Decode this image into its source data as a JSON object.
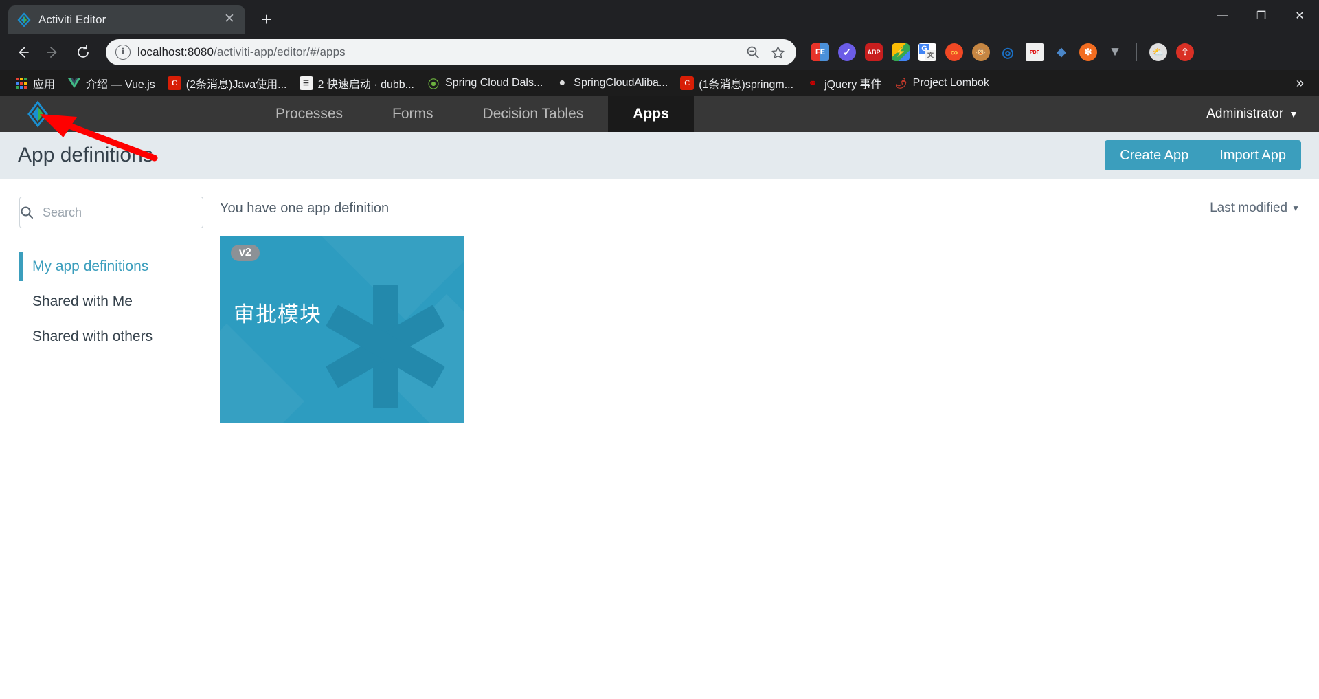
{
  "browser": {
    "tab": {
      "title": "Activiti Editor",
      "favicon_icon": "activiti-diamond-icon",
      "close_icon": "close-icon"
    },
    "new_tab_label": "+",
    "window_controls": {
      "minimize": "—",
      "maximize": "❐",
      "close": "✕"
    },
    "nav": {
      "back_icon": "back-arrow-icon",
      "forward_icon": "forward-arrow-icon",
      "reload_icon": "reload-icon"
    },
    "omnibox": {
      "info_icon": "info-circle-icon",
      "url_host": "localhost:8080",
      "url_path": "/activiti-app/editor/#/apps",
      "zoom_icon": "zoom-out-icon",
      "bookmark_icon": "star-icon"
    },
    "extensions": [
      {
        "name": "fe-helper-icon",
        "label": "FE",
        "color": "#e8342a"
      },
      {
        "name": "check-circle-icon",
        "label": "✓",
        "color": "#6b5ce7"
      },
      {
        "name": "adblock-plus-icon",
        "label": "ABP",
        "color": "#c81e1e"
      },
      {
        "name": "fatkun-icon",
        "label": "⚡",
        "color": "#4285f4"
      },
      {
        "name": "google-translate-icon",
        "label": "G",
        "color": "#4285f4"
      },
      {
        "name": "infinity-icon",
        "label": "∞",
        "color": "#f04824"
      },
      {
        "name": "monkey-icon",
        "label": "🐵",
        "color": "#b5651d"
      },
      {
        "name": "leaf-icon",
        "label": "◡",
        "color": "#1a6fc4"
      },
      {
        "name": "pdfjs-icon",
        "label": "PDF",
        "color": "#e8e8e8"
      },
      {
        "name": "proxy-switch-icon",
        "label": "◆",
        "color": "#4a86c8"
      },
      {
        "name": "orange-dot-icon",
        "label": "✣",
        "color": "#f26d21"
      },
      {
        "name": "vue-devtools-icon",
        "label": "V",
        "color": "#9aa0a6"
      }
    ],
    "profile_icon": "profile-avatar-icon",
    "update_icon": "update-arrow-icon",
    "bookmarks": [
      {
        "label": "应用",
        "icon": "apps-grid-icon",
        "color": "#f4b400"
      },
      {
        "label": "介绍 — Vue.js",
        "icon": "vuejs-icon",
        "color": "#41b883"
      },
      {
        "label": "(2条消息)Java使用...",
        "icon": "csdn-icon",
        "color": "#d81e06"
      },
      {
        "label": "2 快速启动 · dubb...",
        "icon": "dubbo-icon",
        "color": "#5c6bc0"
      },
      {
        "label": "Spring Cloud Dals...",
        "icon": "spring-leaf-icon",
        "color": "#6db33f"
      },
      {
        "label": "SpringCloudAliba...",
        "icon": "github-icon",
        "color": "#24292e"
      },
      {
        "label": "(1条消息)springm...",
        "icon": "csdn-icon",
        "color": "#d81e06"
      },
      {
        "label": "jQuery 事件",
        "icon": "jquery-icon",
        "color": "#cc0000"
      },
      {
        "label": "Project Lombok",
        "icon": "lombok-icon",
        "color": "#c0392b"
      }
    ],
    "bookmarks_overflow_label": "»"
  },
  "activiti": {
    "logo_icon": "activiti-logo-icon",
    "nav_tabs": [
      {
        "label": "Processes",
        "active": false
      },
      {
        "label": "Forms",
        "active": false
      },
      {
        "label": "Decision Tables",
        "active": false
      },
      {
        "label": "Apps",
        "active": true
      }
    ],
    "user_menu": {
      "label": "Administrator",
      "chevron_icon": "chevron-down-icon"
    },
    "page_title": "App definitions",
    "actions": {
      "create_label": "Create App",
      "import_label": "Import App"
    },
    "search": {
      "placeholder": "Search",
      "value": "",
      "icon": "search-icon"
    },
    "sidebar_items": [
      {
        "label": "My app definitions",
        "active": true
      },
      {
        "label": "Shared with Me",
        "active": false
      },
      {
        "label": "Shared with others",
        "active": false
      }
    ],
    "result_count_text": "You have one app definition",
    "sort": {
      "label": "Last modified",
      "chevron_icon": "caret-down-icon"
    },
    "app_cards": [
      {
        "title": "审批模块",
        "version_badge": "v2",
        "color": "#2d9cc0",
        "icon": "asterisk-icon"
      }
    ],
    "colors": {
      "accent": "#3b9ebd",
      "nav_bg": "#373737",
      "page_head_bg": "#e4eaee",
      "card_bg": "#2d9cc0"
    }
  },
  "annotation": {
    "arrow_color": "#ff0000",
    "points_to": "activiti-logo-icon"
  }
}
